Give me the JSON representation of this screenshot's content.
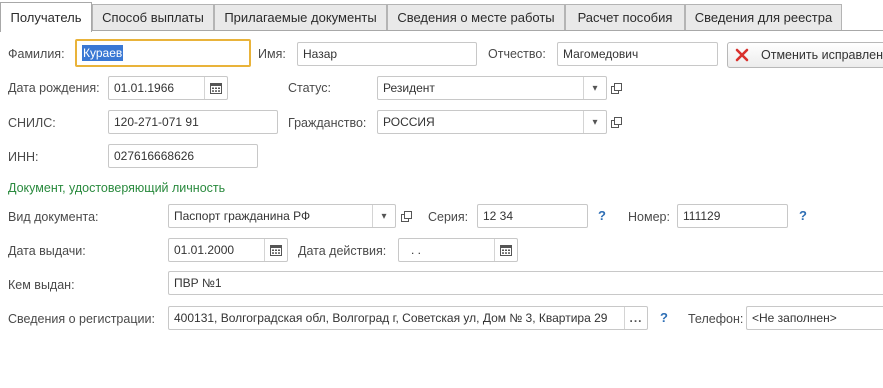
{
  "tabs": [
    {
      "label": "Получатель"
    },
    {
      "label": "Способ выплаты"
    },
    {
      "label": "Прилагаемые документы"
    },
    {
      "label": "Сведения о месте работы"
    },
    {
      "label": "Расчет пособия"
    },
    {
      "label": "Сведения для реестра"
    }
  ],
  "person": {
    "surname_label": "Фамилия:",
    "surname_value": "Кураев",
    "name_label": "Имя:",
    "name_value": "Назар",
    "patronymic_label": "Отчество:",
    "patronymic_value": "Магомедович",
    "cancel_button": "Отменить исправлен",
    "birthdate_label": "Дата рождения:",
    "birthdate_value": "01.01.1966",
    "status_label": "Статус:",
    "status_value": "Резидент",
    "snils_label": "СНИЛС:",
    "snils_value": "120-271-071 91",
    "citizenship_label": "Гражданство:",
    "citizenship_value": "РОССИЯ",
    "inn_label": "ИНН:",
    "inn_value": "027616668626"
  },
  "document": {
    "section_title": "Документ, удостоверяющий личность",
    "type_label": "Вид документа:",
    "type_value": "Паспорт гражданина РФ",
    "series_label": "Серия:",
    "series_value": "12 34",
    "number_label": "Номер:",
    "number_value": "111129",
    "issue_date_label": "Дата выдачи:",
    "issue_date_value": "01.01.2000",
    "valid_date_label": "Дата действия:",
    "valid_date_value": ". .",
    "issued_by_label": "Кем выдан:",
    "issued_by_value": "ПВР №1",
    "registration_label": "Сведения о регистрации:",
    "registration_value": "400131, Волгоградская обл, Волгоград г, Советская ул, Дом № 3, Квартира 29",
    "phone_label": "Телефон:",
    "phone_value": "<Не заполнен>",
    "help_mark": "?",
    "ellipsis": "..."
  },
  "icons": {
    "calendar": "calendar-icon",
    "dropdown": "chevron-down-icon",
    "open": "open-form-icon",
    "cancel": "red-x-icon"
  },
  "colors": {
    "section": "#2a8a3e",
    "help": "#2f6fb5",
    "focus": "#e9b33a",
    "selection": "#3a78d4",
    "cancel_icon": "#d9302c"
  }
}
